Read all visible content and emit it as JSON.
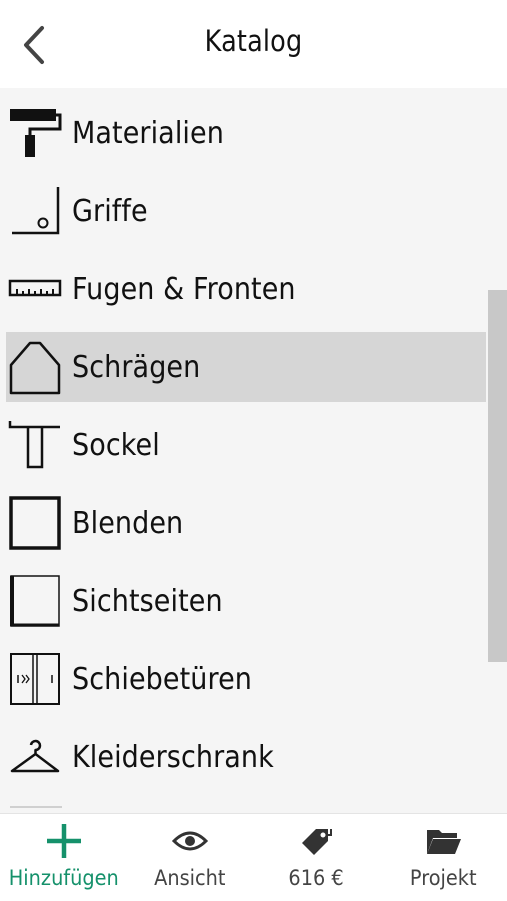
{
  "header": {
    "title": "Katalog",
    "back_icon": "chevron-left-icon"
  },
  "catalog": {
    "selected": "Schrägen",
    "items": [
      {
        "label": "Materialien",
        "icon": "paint-roller-icon"
      },
      {
        "label": "Griffe",
        "icon": "handle-icon"
      },
      {
        "label": "Fugen & Fronten",
        "icon": "ruler-icon"
      },
      {
        "label": "Schrägen",
        "icon": "slope-icon"
      },
      {
        "label": "Sockel",
        "icon": "plinth-icon"
      },
      {
        "label": "Blenden",
        "icon": "panel-frame-icon"
      },
      {
        "label": "Sichtseiten",
        "icon": "side-panel-icon"
      },
      {
        "label": "Schiebetüren",
        "icon": "sliding-door-icon"
      },
      {
        "label": "Kleiderschrank",
        "icon": "hanger-icon"
      }
    ]
  },
  "tabbar": {
    "accent_color": "#15916b",
    "tabs": [
      {
        "label": "Hinzufügen",
        "icon": "plus-icon",
        "active": true
      },
      {
        "label": "Ansicht",
        "icon": "eye-icon",
        "active": false
      },
      {
        "label": "616 €",
        "icon": "price-tag-icon",
        "active": false
      },
      {
        "label": "Projekt",
        "icon": "folder-icon",
        "active": false
      }
    ]
  }
}
